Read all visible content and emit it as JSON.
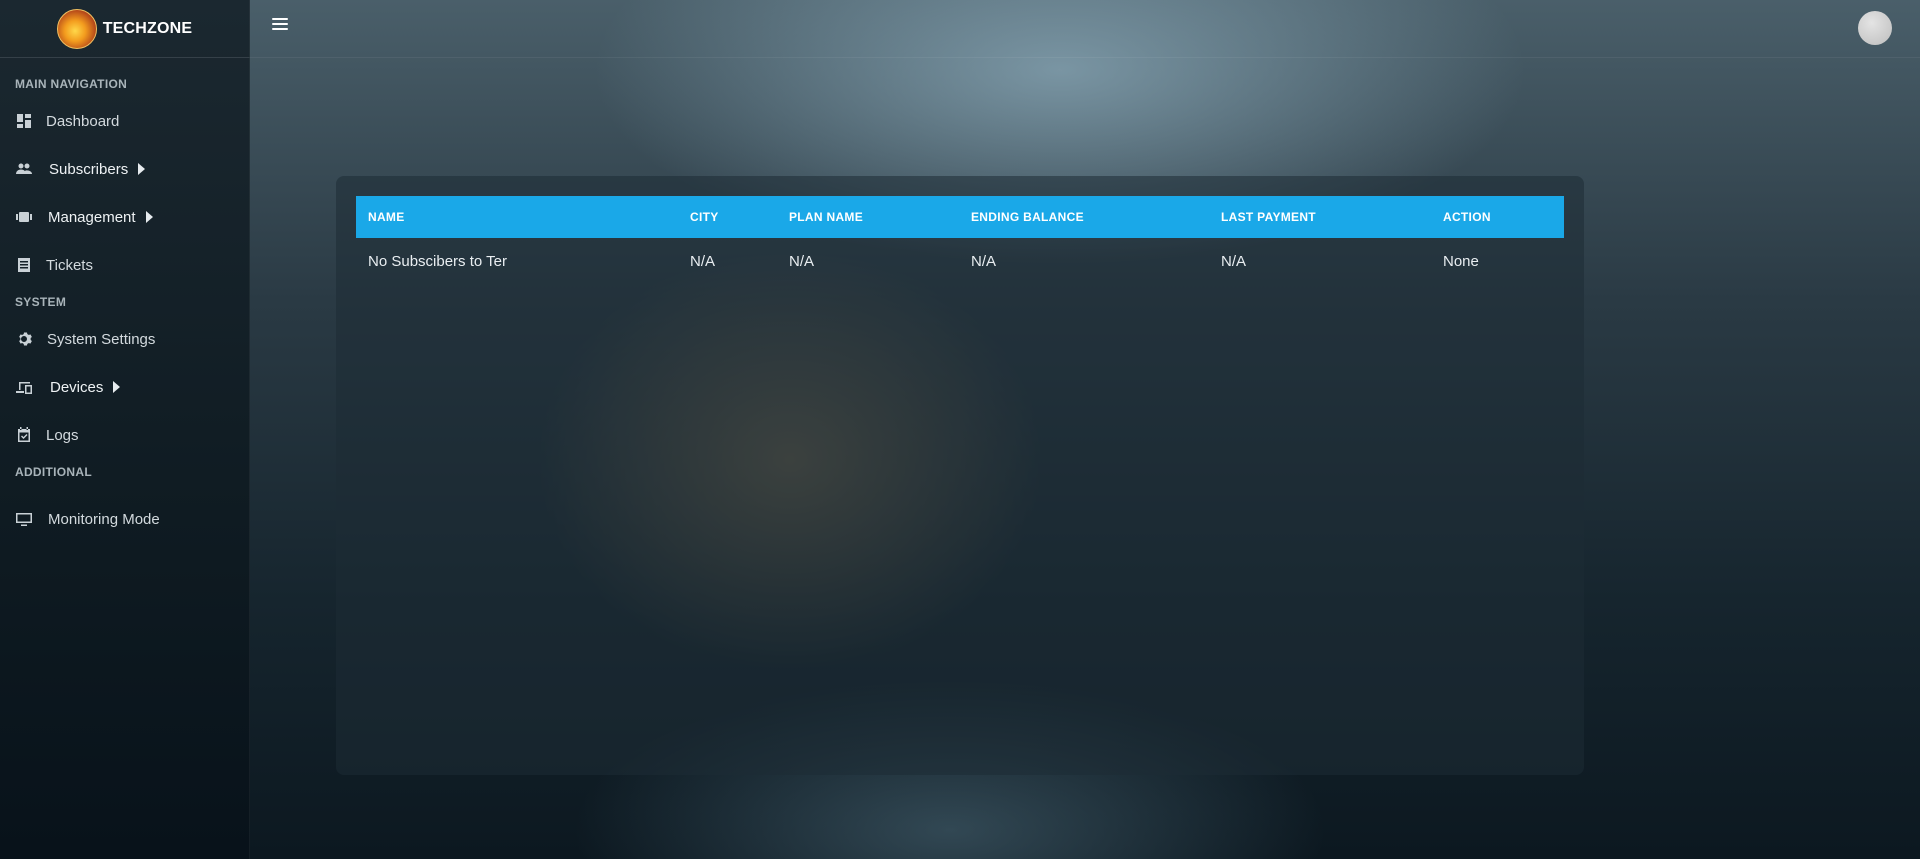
{
  "brand": {
    "name": "TECHZONE"
  },
  "sidebar": {
    "sections": [
      {
        "label": "MAIN NAVIGATION"
      },
      {
        "label": "SYSTEM"
      },
      {
        "label": "ADDITIONAL"
      }
    ],
    "items": [
      {
        "label": "Dashboard",
        "icon": "dashboard-icon"
      },
      {
        "label": "Subscribers",
        "icon": "people-icon",
        "has_submenu": true
      },
      {
        "label": "Management",
        "icon": "film-icon",
        "has_submenu": true
      },
      {
        "label": "Tickets",
        "icon": "list-icon"
      },
      {
        "label": "System Settings",
        "icon": "gear-icon"
      },
      {
        "label": "Devices",
        "icon": "devices-icon",
        "has_submenu": true
      },
      {
        "label": "Logs",
        "icon": "calendar-check-icon"
      },
      {
        "label": "Monitoring Mode",
        "icon": "monitor-icon"
      }
    ]
  },
  "table": {
    "headers": [
      "NAME",
      "CITY",
      "PLAN NAME",
      "ENDING BALANCE",
      "LAST PAYMENT",
      "ACTION"
    ],
    "rows": [
      [
        "No Subscibers to Ter",
        "N/A",
        "N/A",
        "N/A",
        "N/A",
        "None"
      ]
    ]
  },
  "colors": {
    "header_accent": "#1aa8e8",
    "sidebar_bg": "#0f1b22"
  }
}
